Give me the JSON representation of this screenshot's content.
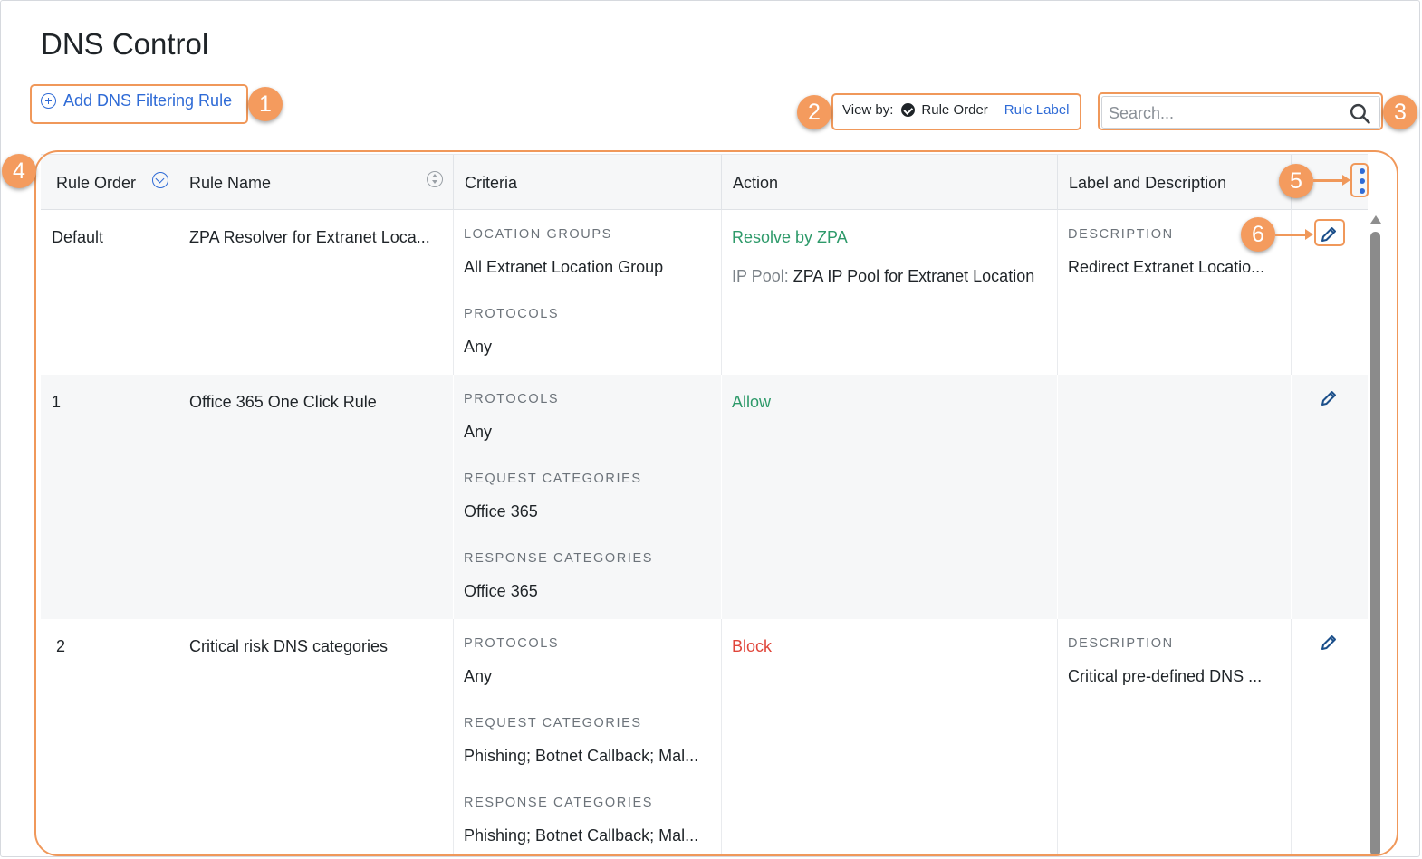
{
  "page": {
    "title": "DNS Control"
  },
  "toolbar": {
    "add_label": "Add DNS Filtering Rule",
    "view_by_label": "View by:",
    "view_by_selected": "Rule Order",
    "view_by_other": "Rule Label",
    "search_placeholder": "Search..."
  },
  "callouts": [
    "1",
    "2",
    "3",
    "4",
    "5",
    "6"
  ],
  "table": {
    "columns": [
      "Rule Order",
      "Rule Name",
      "Criteria",
      "Action",
      "Label and Description"
    ],
    "rows": [
      {
        "order": "Default",
        "name": "ZPA Resolver for Extranet Loca...",
        "criteria": [
          {
            "label": "LOCATION GROUPS",
            "value": "All Extranet Location Group"
          },
          {
            "label": "PROTOCOLS",
            "value": "Any"
          }
        ],
        "action": "Resolve by ZPA",
        "action_detail_label": "IP Pool:",
        "action_detail_value": "ZPA IP Pool for Extranet Location",
        "description_label": "DESCRIPTION",
        "description": "Redirect Extranet Locatio..."
      },
      {
        "order": "1",
        "name": "Office 365 One Click Rule",
        "criteria": [
          {
            "label": "PROTOCOLS",
            "value": "Any"
          },
          {
            "label": "REQUEST CATEGORIES",
            "value": "Office 365"
          },
          {
            "label": "RESPONSE CATEGORIES",
            "value": "Office 365"
          }
        ],
        "action": "Allow"
      },
      {
        "order": "2",
        "name": "Critical risk DNS categories",
        "criteria": [
          {
            "label": "PROTOCOLS",
            "value": "Any"
          },
          {
            "label": "REQUEST CATEGORIES",
            "value": "Phishing; Botnet Callback; Mal..."
          },
          {
            "label": "RESPONSE CATEGORIES",
            "value": "Phishing; Botnet Callback; Mal..."
          }
        ],
        "action": "Block",
        "description_label": "DESCRIPTION",
        "description": "Critical pre-defined DNS ..."
      }
    ]
  },
  "colors": {
    "accent": "#2f6bd6",
    "callout": "#f0985a",
    "allow": "#2e9a6a",
    "block": "#e0453a"
  },
  "icons": [
    "plus-circle-icon",
    "check-circle-icon",
    "search-icon",
    "sort-desc-icon",
    "sort-icon",
    "kebab-menu-icon",
    "pencil-icon"
  ]
}
